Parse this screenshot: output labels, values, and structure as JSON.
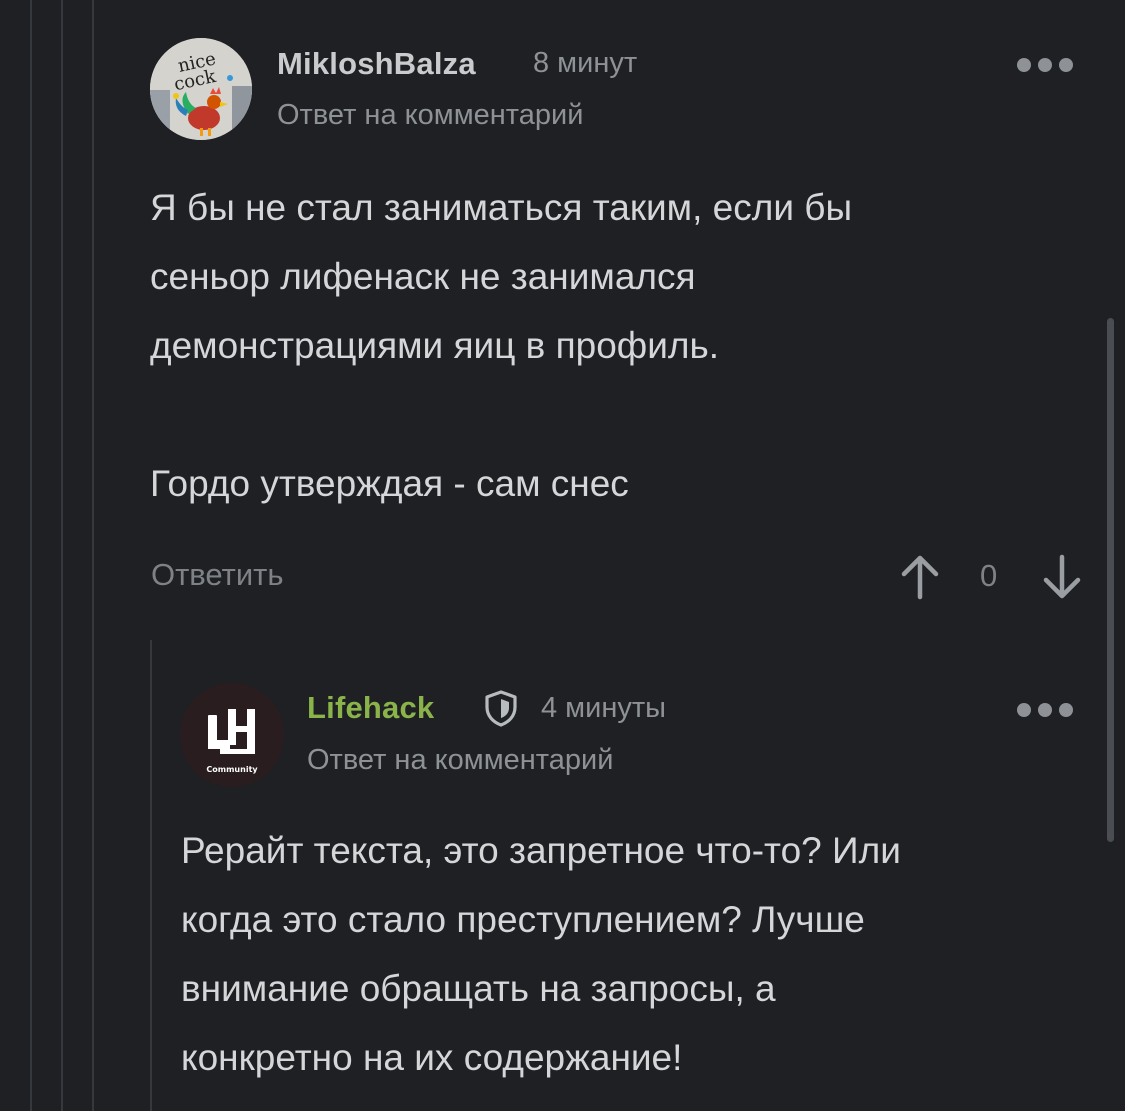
{
  "comment1": {
    "username": "MiklоshBalza",
    "time": "8 минут",
    "reply_label": "Ответ на комментарий",
    "avatar_text_line1": "nice",
    "avatar_text_line2": "cock",
    "paragraphs": [
      "Я бы не стал заниматься таким, если бы",
      "сеньор лифенаск не занимался",
      "демонстрациями яиц в профиль.",
      "",
      "Гордо утверждая - сам снес"
    ],
    "reply_button": "Ответить",
    "score": "0",
    "more_icon": "more-dots-icon",
    "upvote_icon": "arrow-up-icon",
    "downvote_icon": "arrow-down-icon"
  },
  "comment2": {
    "username": "Lifehack",
    "badge_icon": "shield-icon",
    "time": "4 минуты",
    "reply_label": "Ответ на комментарий",
    "avatar_logo_text": "Community",
    "paragraphs": [
      "Рерайт текста, это запретное что-то? Или",
      "когда это стало преступлением? Лучше",
      "внимание обращать на запросы, а",
      "конкретно на их содержание!"
    ],
    "more_icon": "more-dots-icon"
  },
  "colors": {
    "background": "#1e2023",
    "username1": "#c9cbcd",
    "username2": "#8ab34a",
    "text": "#d4d6d8",
    "muted": "#8e9296"
  }
}
